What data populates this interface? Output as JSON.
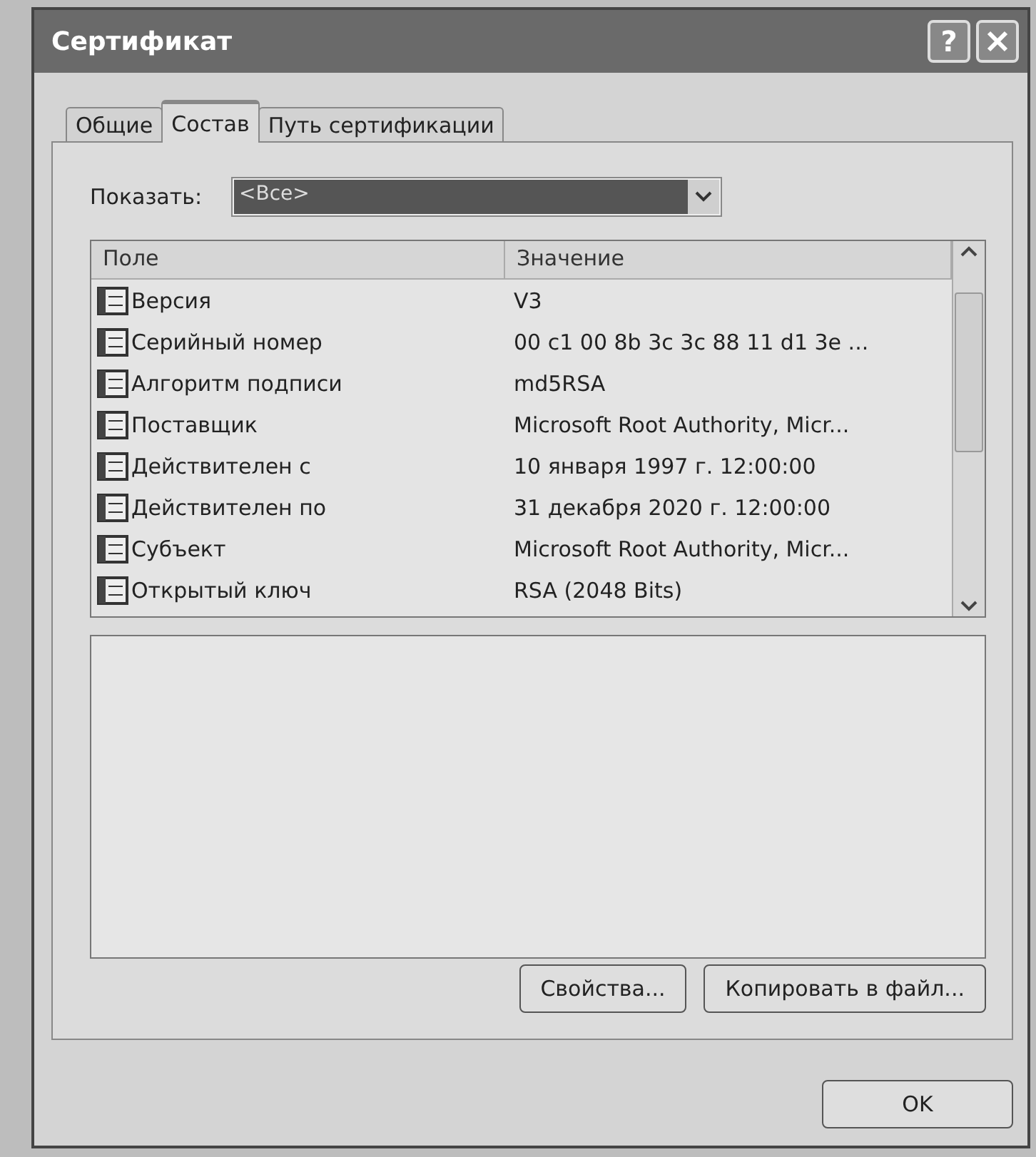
{
  "window": {
    "title": "Сертификат",
    "help_glyph": "?"
  },
  "tabs": [
    {
      "label": "Общие",
      "selected": false
    },
    {
      "label": "Состав",
      "selected": true
    },
    {
      "label": "Путь сертификации",
      "selected": false
    }
  ],
  "show_filter": {
    "label": "Показать:",
    "value": "<Все>"
  },
  "fields_table": {
    "columns": [
      "Поле",
      "Значение"
    ],
    "rows": [
      {
        "field": "Версия",
        "value": "V3",
        "selected": false
      },
      {
        "field": "Серийный номер",
        "value": "00 c1 00 8b 3c 3c 88 11 d1 3e ...",
        "selected": false
      },
      {
        "field": "Алгоритм подписи",
        "value": "md5RSA",
        "selected": false
      },
      {
        "field": "Поставщик",
        "value": "Microsoft Root Authority, Micr...",
        "selected": false
      },
      {
        "field": "Действителен с",
        "value": "10 января 1997 г. 12:00:00",
        "selected": false
      },
      {
        "field": "Действителен по",
        "value": "31 декабря 2020 г. 12:00:00",
        "selected": false
      },
      {
        "field": "Субъект",
        "value": "Microsoft Root Authority, Micr...",
        "selected": false
      },
      {
        "field": "Открытый ключ",
        "value": "RSA (2048 Bits)",
        "selected": false
      }
    ]
  },
  "detail_buttons": [
    "Свойства...",
    "Копировать в файл..."
  ],
  "dialog_buttons": [
    "OK"
  ]
}
